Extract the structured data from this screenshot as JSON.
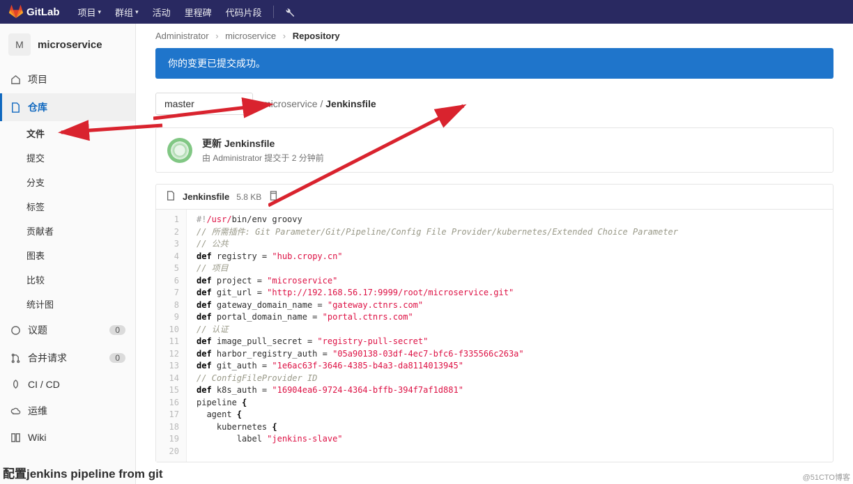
{
  "topnav": {
    "brand": "GitLab",
    "items": [
      "项目",
      "群组",
      "活动",
      "里程碑",
      "代码片段"
    ]
  },
  "project": {
    "avatar_letter": "M",
    "name": "microservice"
  },
  "sidebar": {
    "items": [
      {
        "label": "项目",
        "icon": "home"
      },
      {
        "label": "仓库",
        "icon": "doc",
        "active": true
      },
      {
        "label": "议题",
        "icon": "issues",
        "count": "0"
      },
      {
        "label": "合并请求",
        "icon": "merge",
        "count": "0"
      },
      {
        "label": "CI / CD",
        "icon": "rocket"
      },
      {
        "label": "运维",
        "icon": "cloud"
      },
      {
        "label": "Wiki",
        "icon": "book"
      }
    ],
    "repo_sub": [
      "文件",
      "提交",
      "分支",
      "标签",
      "贡献者",
      "图表",
      "比较",
      "统计图"
    ],
    "repo_sub_active": "文件"
  },
  "breadcrumb": {
    "a": "Administrator",
    "b": "microservice",
    "c": "Repository"
  },
  "banner": "你的变更已提交成功。",
  "branch": "master",
  "path": {
    "root": "microservice",
    "file": "Jenkinsfile"
  },
  "commit": {
    "title": "更新 Jenkinsfile",
    "meta_prefix": "由 ",
    "author": "Administrator",
    "meta_mid": " 提交于 ",
    "time": "2 分钟前"
  },
  "filebox": {
    "name": "Jenkinsfile",
    "size": "5.8 KB"
  },
  "code": [
    {
      "n": 1,
      "t": [
        [
          "she1",
          "#!"
        ],
        [
          "she2",
          "/usr/"
        ],
        [
          "",
          "bin/env groovy"
        ]
      ]
    },
    {
      "n": 2,
      "t": [
        [
          "com",
          "// 所需插件: Git Parameter/Git/Pipeline/Config File Provider/kubernetes/Extended Choice Parameter"
        ]
      ]
    },
    {
      "n": 3,
      "t": [
        [
          "com",
          "// 公共"
        ]
      ]
    },
    {
      "n": 4,
      "t": [
        [
          "def",
          "def"
        ],
        [
          "",
          " registry = "
        ],
        [
          "str",
          "\"hub.cropy.cn\""
        ]
      ]
    },
    {
      "n": 5,
      "t": [
        [
          "com",
          "// 项目"
        ]
      ]
    },
    {
      "n": 6,
      "t": [
        [
          "def",
          "def"
        ],
        [
          "",
          " project = "
        ],
        [
          "str",
          "\"microservice\""
        ]
      ]
    },
    {
      "n": 7,
      "t": [
        [
          "def",
          "def"
        ],
        [
          "",
          " git_url = "
        ],
        [
          "str",
          "\"http://192.168.56.17:9999/root/microservice.git\""
        ]
      ]
    },
    {
      "n": 8,
      "t": [
        [
          "def",
          "def"
        ],
        [
          "",
          " gateway_domain_name = "
        ],
        [
          "str",
          "\"gateway.ctnrs.com\""
        ]
      ]
    },
    {
      "n": 9,
      "t": [
        [
          "def",
          "def"
        ],
        [
          "",
          " portal_domain_name = "
        ],
        [
          "str",
          "\"portal.ctnrs.com\""
        ]
      ]
    },
    {
      "n": 10,
      "t": [
        [
          "com",
          "// 认证"
        ]
      ]
    },
    {
      "n": 11,
      "t": [
        [
          "def",
          "def"
        ],
        [
          "",
          " image_pull_secret = "
        ],
        [
          "str",
          "\"registry-pull-secret\""
        ]
      ]
    },
    {
      "n": 12,
      "t": [
        [
          "def",
          "def"
        ],
        [
          "",
          " harbor_registry_auth = "
        ],
        [
          "str",
          "\"05a90138-03df-4ec7-bfc6-f335566c263a\""
        ]
      ]
    },
    {
      "n": 13,
      "t": [
        [
          "def",
          "def"
        ],
        [
          "",
          " git_auth = "
        ],
        [
          "str",
          "\"1e6ac63f-3646-4385-b4a3-da8114013945\""
        ]
      ]
    },
    {
      "n": 14,
      "t": [
        [
          "com",
          "// ConfigFileProvider ID"
        ]
      ]
    },
    {
      "n": 15,
      "t": [
        [
          "def",
          "def"
        ],
        [
          "",
          " k8s_auth = "
        ],
        [
          "str",
          "\"16904ea6-9724-4364-bffb-394f7af1d881\""
        ]
      ]
    },
    {
      "n": 16,
      "t": [
        [
          "",
          ""
        ]
      ]
    },
    {
      "n": 17,
      "t": [
        [
          "",
          "pipeline "
        ],
        [
          "def",
          "{"
        ]
      ]
    },
    {
      "n": 18,
      "t": [
        [
          "",
          "  agent "
        ],
        [
          "def",
          "{"
        ]
      ]
    },
    {
      "n": 19,
      "t": [
        [
          "",
          "    kubernetes "
        ],
        [
          "def",
          "{"
        ]
      ]
    },
    {
      "n": 20,
      "t": [
        [
          "",
          "        label "
        ],
        [
          "str",
          "\"jenkins-slave\""
        ]
      ]
    }
  ],
  "footer_note": "配置jenkins pipeline from git",
  "watermark": "@51CTO博客"
}
